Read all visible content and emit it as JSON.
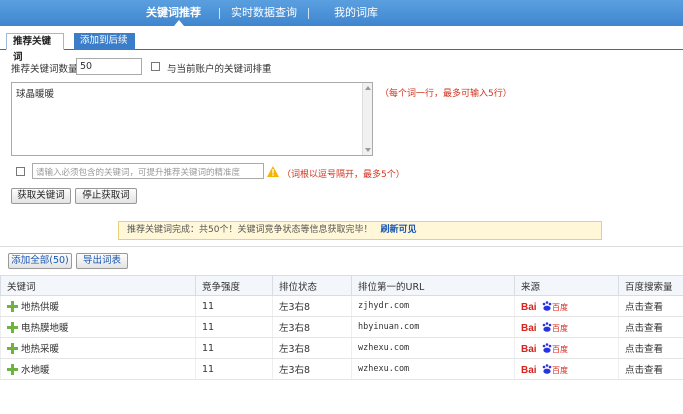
{
  "topnav": {
    "items": [
      "关键词推荐",
      "实时数据查询",
      "我的词库"
    ]
  },
  "subtabs": [
    "推荐关键词",
    "添加到后续"
  ],
  "form": {
    "count_label": "推荐关键词数量",
    "count_value": "50",
    "exclude_label": "与当前账户的关键词排重",
    "seed_text": "球晶暖暖",
    "seed_hint": "（每个词一行，最多可输入5行）",
    "filter_placeholder": "请输入必须包含的关键词，可提升推荐关键词的精准度",
    "filter_hint": "（词根以逗号隔开，最多5个）",
    "get_button": "获取关键词",
    "stop_button": "停止获取词"
  },
  "notice": {
    "text": "推荐关键词完成：共50个！关键词竞争状态等信息获取完毕！",
    "link": "刷新可见"
  },
  "actions": {
    "add_all": "添加全部(50)",
    "export": "导出词表"
  },
  "table": {
    "headers": [
      "关键词",
      "竞争强度",
      "排位状态",
      "排位第一的URL",
      "来源",
      "百度搜索量"
    ],
    "rows": [
      {
        "keyword": "地热供暖",
        "competition": "11",
        "rank": "左3右8",
        "url": "zjhydr.com",
        "source": "Bai百度",
        "search": "点击查看"
      },
      {
        "keyword": "电热膜地暖",
        "competition": "11",
        "rank": "左3右8",
        "url": "hbyinuan.com",
        "source": "Bai百度",
        "search": "点击查看"
      },
      {
        "keyword": "地热采暖",
        "competition": "11",
        "rank": "左3右8",
        "url": "wzhexu.com",
        "source": "Bai百度",
        "search": "点击查看"
      },
      {
        "keyword": "水地暖",
        "competition": "11",
        "rank": "左3右8",
        "url": "wzhexu.com",
        "source": "Bai百度",
        "search": "点击查看"
      }
    ]
  },
  "colors": {
    "nav": "#3f86cf",
    "hint_red": "#d2321e",
    "baidu_red": "#d6231c",
    "baidu_blue": "#2932e1",
    "plus_green": "#6db33f"
  }
}
